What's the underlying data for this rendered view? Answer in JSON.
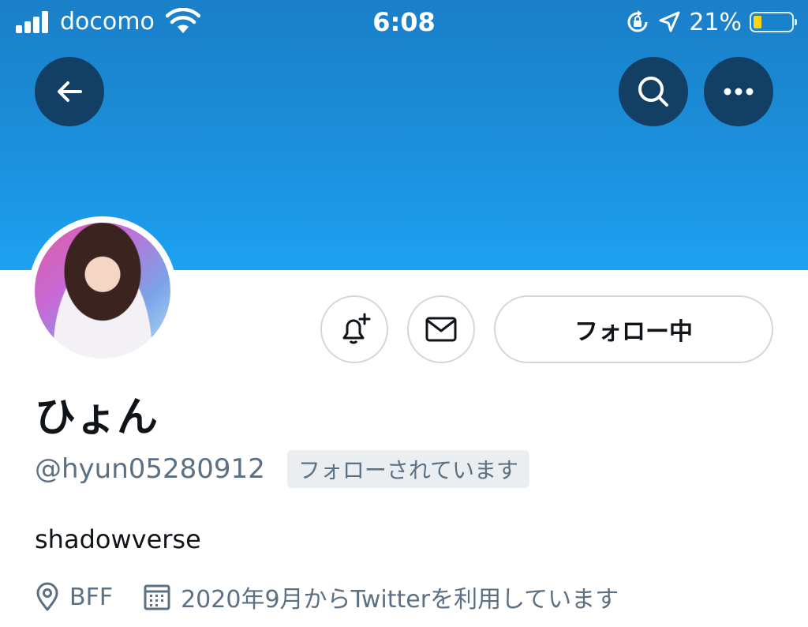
{
  "status_bar": {
    "carrier": "docomo",
    "time": "6:08",
    "battery_percent": "21%",
    "battery_level": 0.21
  },
  "profile": {
    "display_name": "ひょん",
    "handle": "@hyun05280912",
    "follows_you_badge": "フォローされています",
    "bio": "shadowverse",
    "location": "BFF",
    "joined": "2020年9月からTwitterを利用しています",
    "follow_button_label": "フォロー中"
  },
  "icons": {
    "back": "arrow-left-icon",
    "search": "search-icon",
    "more": "more-dots-icon",
    "notify": "bell-plus-icon",
    "message": "envelope-icon",
    "location": "location-pin-icon",
    "calendar": "calendar-icon"
  },
  "colors": {
    "banner": "#1da1f2",
    "nav_button": "#123f63",
    "secondary_text": "#5b7083",
    "badge_bg": "#eaeef1"
  }
}
